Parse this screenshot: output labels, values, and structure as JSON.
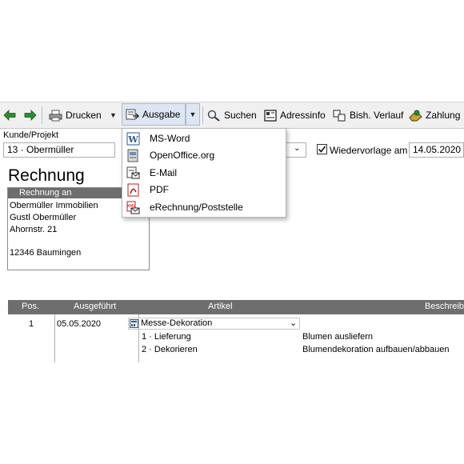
{
  "toolbar": {
    "print_label": "Drucken",
    "output_label": "Ausgabe",
    "search_label": "Suchen",
    "address_info_label": "Adressinfo",
    "history_label": "Bish. Verlauf",
    "payment_label": "Zahlung"
  },
  "customer": {
    "label": "Kunde/Projekt",
    "value": "13 · Obermüller"
  },
  "resubmission": {
    "label": "Wiedervorlage am",
    "checked": true,
    "date": "14.05.2020"
  },
  "output_menu": {
    "items": [
      {
        "label": "MS-Word",
        "icon": "word-icon"
      },
      {
        "label": "OpenOffice.org",
        "icon": "openoffice-icon"
      },
      {
        "label": "E-Mail",
        "icon": "email-icon"
      },
      {
        "label": "PDF",
        "icon": "pdf-icon"
      },
      {
        "label": "eRechnung/Poststelle",
        "icon": "erechnung-icon"
      }
    ]
  },
  "document": {
    "title": "Rechnung",
    "recipient_header": "Rechnung an",
    "address_lines": [
      "Obermüller Immobilien",
      "Gustl Obermüller",
      "Ahornstr. 21",
      "12346 Baumingen"
    ]
  },
  "table": {
    "headers": {
      "pos": "Pos.",
      "executed": "Ausgeführt",
      "article": "Artikel",
      "description": "Beschreibu"
    },
    "row": {
      "pos": "1",
      "date": "05.05.2020",
      "article": "Messe-Dekoration",
      "subitems": [
        {
          "label": "1 · Lieferung",
          "description": "Blumen ausliefern"
        },
        {
          "label": "2 · Dekorieren",
          "description": "Blumendekoration aufbauen/abbauen"
        }
      ]
    }
  },
  "colors": {
    "toolbar_bg": "#f0f0f0",
    "header_bar": "#6e6e6e",
    "arrow_green": "#2e8b2e",
    "selected_button": "#dde6f2"
  }
}
